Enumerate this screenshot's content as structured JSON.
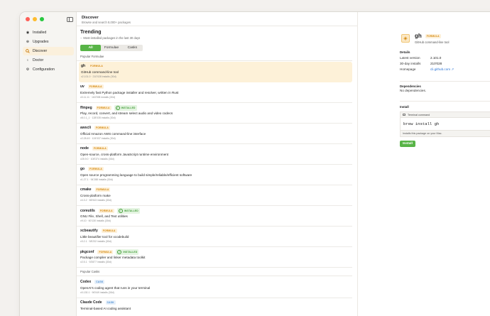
{
  "sidebar": {
    "items": [
      {
        "label": "Installed",
        "icon": "circle-check-icon"
      },
      {
        "label": "Upgrades",
        "icon": "arrow-up-circle-icon"
      },
      {
        "label": "Discover",
        "icon": "magnifier-icon",
        "active": true
      },
      {
        "label": "Doctor",
        "icon": "stethoscope-icon"
      },
      {
        "label": "Configuration",
        "icon": "gear-icon"
      }
    ]
  },
  "header": {
    "title": "Discover",
    "subtitle": "Browse and search 8,000+ packages"
  },
  "trending": {
    "title": "Trending",
    "subtitle": "Most-installed packages in the last 30 days"
  },
  "tabs": [
    "All",
    "Formulae",
    "Casks"
  ],
  "sections": {
    "formulae": "Popular Formulae",
    "casks": "Popular Casks"
  },
  "formulae": [
    {
      "name": "gh",
      "badge": "FORMULA",
      "desc": "GitHub command-line tool",
      "meta": "v2.101.0  ·  210'028 installs (30d)"
    },
    {
      "name": "uv",
      "badge": "FORMULA",
      "desc": "Extremely fast Python package installer and resolver, written in Rust",
      "meta": "v0.11.11  ·  163'398 installs (30d)"
    },
    {
      "name": "ffmpeg",
      "badge": "FORMULA",
      "installed": "INSTALLED",
      "desc": "Play, record, convert, and stream select audio and video codecs",
      "meta": "v8.0.1_1  ·  128'035 installs (30d)"
    },
    {
      "name": "awscli",
      "badge": "FORMULA",
      "desc": "Official Amazon AWS command-line interface",
      "meta": "v2.28.49  ·  124'037 installs (30d)"
    },
    {
      "name": "node",
      "badge": "FORMULA",
      "desc": "Open-source, cross-platform JavaScript runtime environment",
      "meta": "v25.9.0  ·  108'374 installs (30d)"
    },
    {
      "name": "go",
      "badge": "FORMULA",
      "desc": "Open source programming language to build simple/reliable/efficient software",
      "meta": "v1.27.1  ·  94'288 installs (30d)"
    },
    {
      "name": "cmake",
      "badge": "FORMULA",
      "desc": "Cross-platform make",
      "meta": "v4.3.2  ·  86'943 installs (30d)"
    },
    {
      "name": "coreutils",
      "badge": "FORMULA",
      "installed": "INSTALLED",
      "desc": "GNU File, Shell, and Text utilities",
      "meta": "v9.10  ·  60'130 installs (30d)"
    },
    {
      "name": "xcbeautify",
      "badge": "FORMULA",
      "desc": "Little beautifier tool for xcodebuild",
      "meta": "v3.2.1  ·  58'232 installs (30d)"
    },
    {
      "name": "pkgconf",
      "badge": "FORMULA",
      "installed": "INSTALLED",
      "desc": "Package compiler and linker metadata toolkit",
      "meta": "v2.5.1  ·  53'877 installs (30d)"
    }
  ],
  "casks": [
    {
      "name": "Codex",
      "badge": "CASK",
      "desc": "OpenAI's coding agent that runs in your terminal",
      "meta": "v0.130.1  ·  96'049 installs (30d)"
    },
    {
      "name": "Claude Code",
      "badge": "CASK",
      "desc": "Terminal-based AI coding assistant",
      "meta": ""
    }
  ],
  "detail": {
    "name": "gh",
    "badge": "FORMULA",
    "desc": "GitHub command-line tool",
    "details_label": "Details",
    "latest_label": "Latest version",
    "latest_value": "2.101.0",
    "installs_label": "30-day installs",
    "installs_value": "210'028",
    "homepage_label": "Homepage",
    "homepage_value": "cli.github.com ↗",
    "deps_label": "Dependencies",
    "deps_value": "No dependencies.",
    "install_label": "Install",
    "terminal_label": "Terminal command",
    "command": "brew install gh",
    "note": "Installs this package on your Mac.",
    "button": "Install"
  },
  "colors": {
    "accent": "#58b447",
    "formula": "#d4870b",
    "cask": "#4d8fd2",
    "selected": "#fdf1d8"
  }
}
